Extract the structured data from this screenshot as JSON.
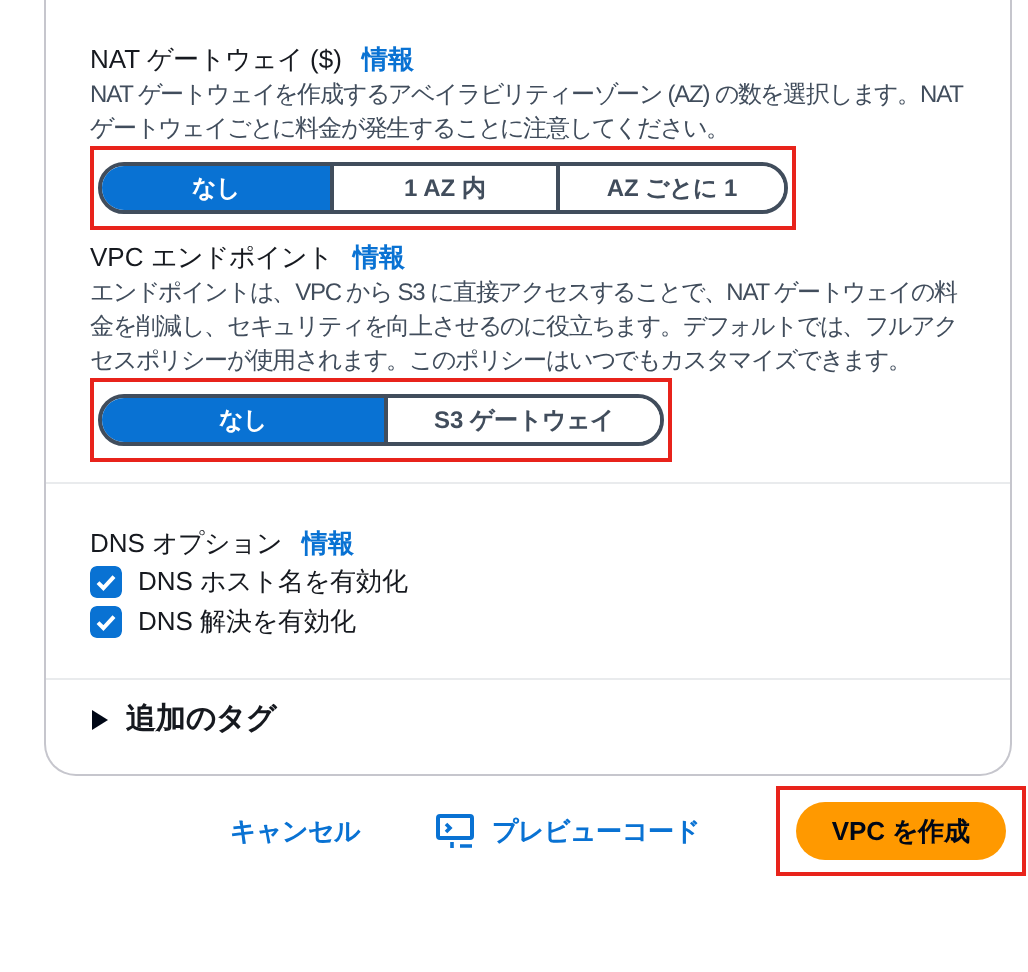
{
  "nat_gateway": {
    "title": "NAT ゲートウェイ ($)",
    "info_link": "情報",
    "description": "NAT ゲートウェイを作成するアベイラビリティーゾーン (AZ) の数を選択します。NAT ゲートウェイごとに料金が発生することに注意してください。",
    "highlighted": true,
    "options": [
      {
        "label": "なし",
        "selected": true
      },
      {
        "label": "1 AZ 内",
        "selected": false
      },
      {
        "label": "AZ ごとに 1",
        "selected": false
      }
    ]
  },
  "vpc_endpoint": {
    "title": "VPC エンドポイント",
    "info_link": "情報",
    "description": "エンドポイントは、VPC から S3 に直接アクセスすることで、NAT ゲートウェイの料金を削減し、セキュリティを向上させるのに役立ちます。デフォルトでは、フルアクセスポリシーが使用されます。このポリシーはいつでもカスタマイズできます。",
    "highlighted": true,
    "options": [
      {
        "label": "なし",
        "selected": true
      },
      {
        "label": "S3 ゲートウェイ",
        "selected": false
      }
    ]
  },
  "dns_options": {
    "title": "DNS オプション",
    "info_link": "情報",
    "checkboxes": [
      {
        "label": "DNS ホスト名を有効化",
        "checked": true
      },
      {
        "label": "DNS 解決を有効化",
        "checked": true
      }
    ]
  },
  "additional_tags": {
    "label": "追加のタグ",
    "expanded": false
  },
  "footer": {
    "cancel": "キャンセル",
    "preview_code": "プレビューコード",
    "create": {
      "label": "VPC を作成",
      "highlighted": true
    }
  }
}
